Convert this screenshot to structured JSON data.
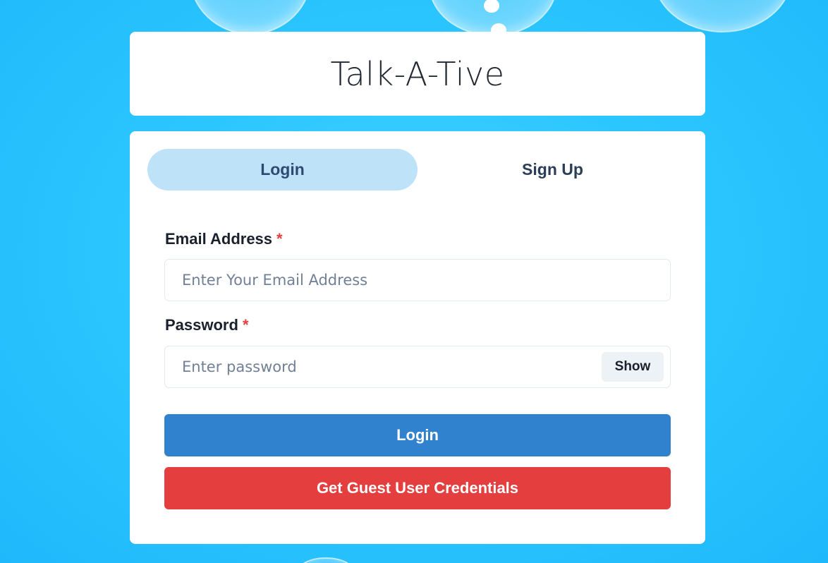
{
  "app": {
    "title": "Talk-A-Tive"
  },
  "tabs": [
    {
      "label": "Login",
      "active": true
    },
    {
      "label": "Sign Up",
      "active": false
    }
  ],
  "form": {
    "email": {
      "label": "Email Address",
      "required_mark": "*",
      "placeholder": "Enter Your Email Address",
      "value": ""
    },
    "password": {
      "label": "Password",
      "required_mark": "*",
      "placeholder": "Enter password",
      "value": "",
      "toggle_label": "Show"
    },
    "login_button": "Login",
    "guest_button": "Get Guest User Credentials"
  },
  "colors": {
    "background": "#2cc6ff",
    "active_tab": "#bee3f8",
    "primary_button": "#3182ce",
    "danger_button": "#e53e3e",
    "required_mark": "#e53e3e"
  }
}
